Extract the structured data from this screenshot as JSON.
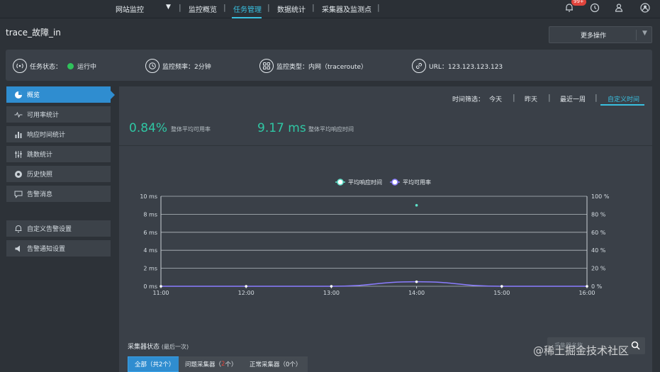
{
  "nav": {
    "items": [
      "网站监控",
      "监控概览",
      "任务管理",
      "数据统计",
      "采集器及监测点"
    ],
    "active_index": 2,
    "notification_badge": "99+"
  },
  "page": {
    "title": "trace_故障_in",
    "more_actions": "更多操作"
  },
  "info": {
    "status_label": "任务状态：",
    "status_value": "运行中",
    "frequency": "监控频率：2分钟",
    "type": "监控类型：内网（traceroute）",
    "url": "URL：123.123.123.123"
  },
  "sidebar": {
    "items": [
      {
        "label": "概览",
        "icon": "overview-icon",
        "active": true
      },
      {
        "label": "可用率统计",
        "icon": "pulse-icon"
      },
      {
        "label": "响应时间统计",
        "icon": "bar-chart-icon"
      },
      {
        "label": "跳数统计",
        "icon": "sliders-icon"
      },
      {
        "label": "历史快照",
        "icon": "snapshot-icon"
      },
      {
        "label": "告警消息",
        "icon": "message-icon"
      },
      {
        "label": "自定义告警设置",
        "icon": "bell-icon"
      },
      {
        "label": "告警通知设置",
        "icon": "speaker-icon"
      }
    ]
  },
  "time_filter": {
    "label": "时间筛选：",
    "options": [
      "今天",
      "昨天",
      "最近一周",
      "自定义时间"
    ],
    "active_index": 3
  },
  "stats": {
    "availability_value": "0.84%",
    "availability_label": "整体平均可用率",
    "response_value": "9.17 ms",
    "response_label": "整体平均响应时间"
  },
  "chart_data": {
    "type": "line",
    "x": [
      "11:00",
      "12:00",
      "13:00",
      "14:00",
      "15:00",
      "16:00"
    ],
    "series": [
      {
        "name": "平均响应时间",
        "axis": "left",
        "color": "#5ee0c8",
        "values": [
          null,
          null,
          null,
          9,
          null,
          null
        ]
      },
      {
        "name": "平均可用率",
        "axis": "right",
        "color": "#8a7cff",
        "values": [
          0,
          0,
          0,
          5,
          0,
          0
        ]
      }
    ],
    "y_left": {
      "ticks": [
        "0 ms",
        "2 ms",
        "4 ms",
        "6 ms",
        "8 ms",
        "10 ms"
      ],
      "ylim": [
        0,
        10
      ]
    },
    "y_right": {
      "ticks": [
        "0 %",
        "20 %",
        "40 %",
        "60 %",
        "80 %",
        "100 %"
      ],
      "ylim": [
        0,
        100
      ]
    },
    "legend_position": "top-center",
    "grid": true
  },
  "collectors": {
    "title": "采集器状态",
    "subtitle": "(最后一次)",
    "search_placeholder": "采集器名称",
    "tabs": [
      {
        "text": "全部（共2个）"
      },
      {
        "prefix": "问题采集器（",
        "count": "2",
        "suffix": "个）"
      },
      {
        "text": "正常采集器（0个）"
      }
    ]
  },
  "watermark": "@稀土掘金技术社区"
}
